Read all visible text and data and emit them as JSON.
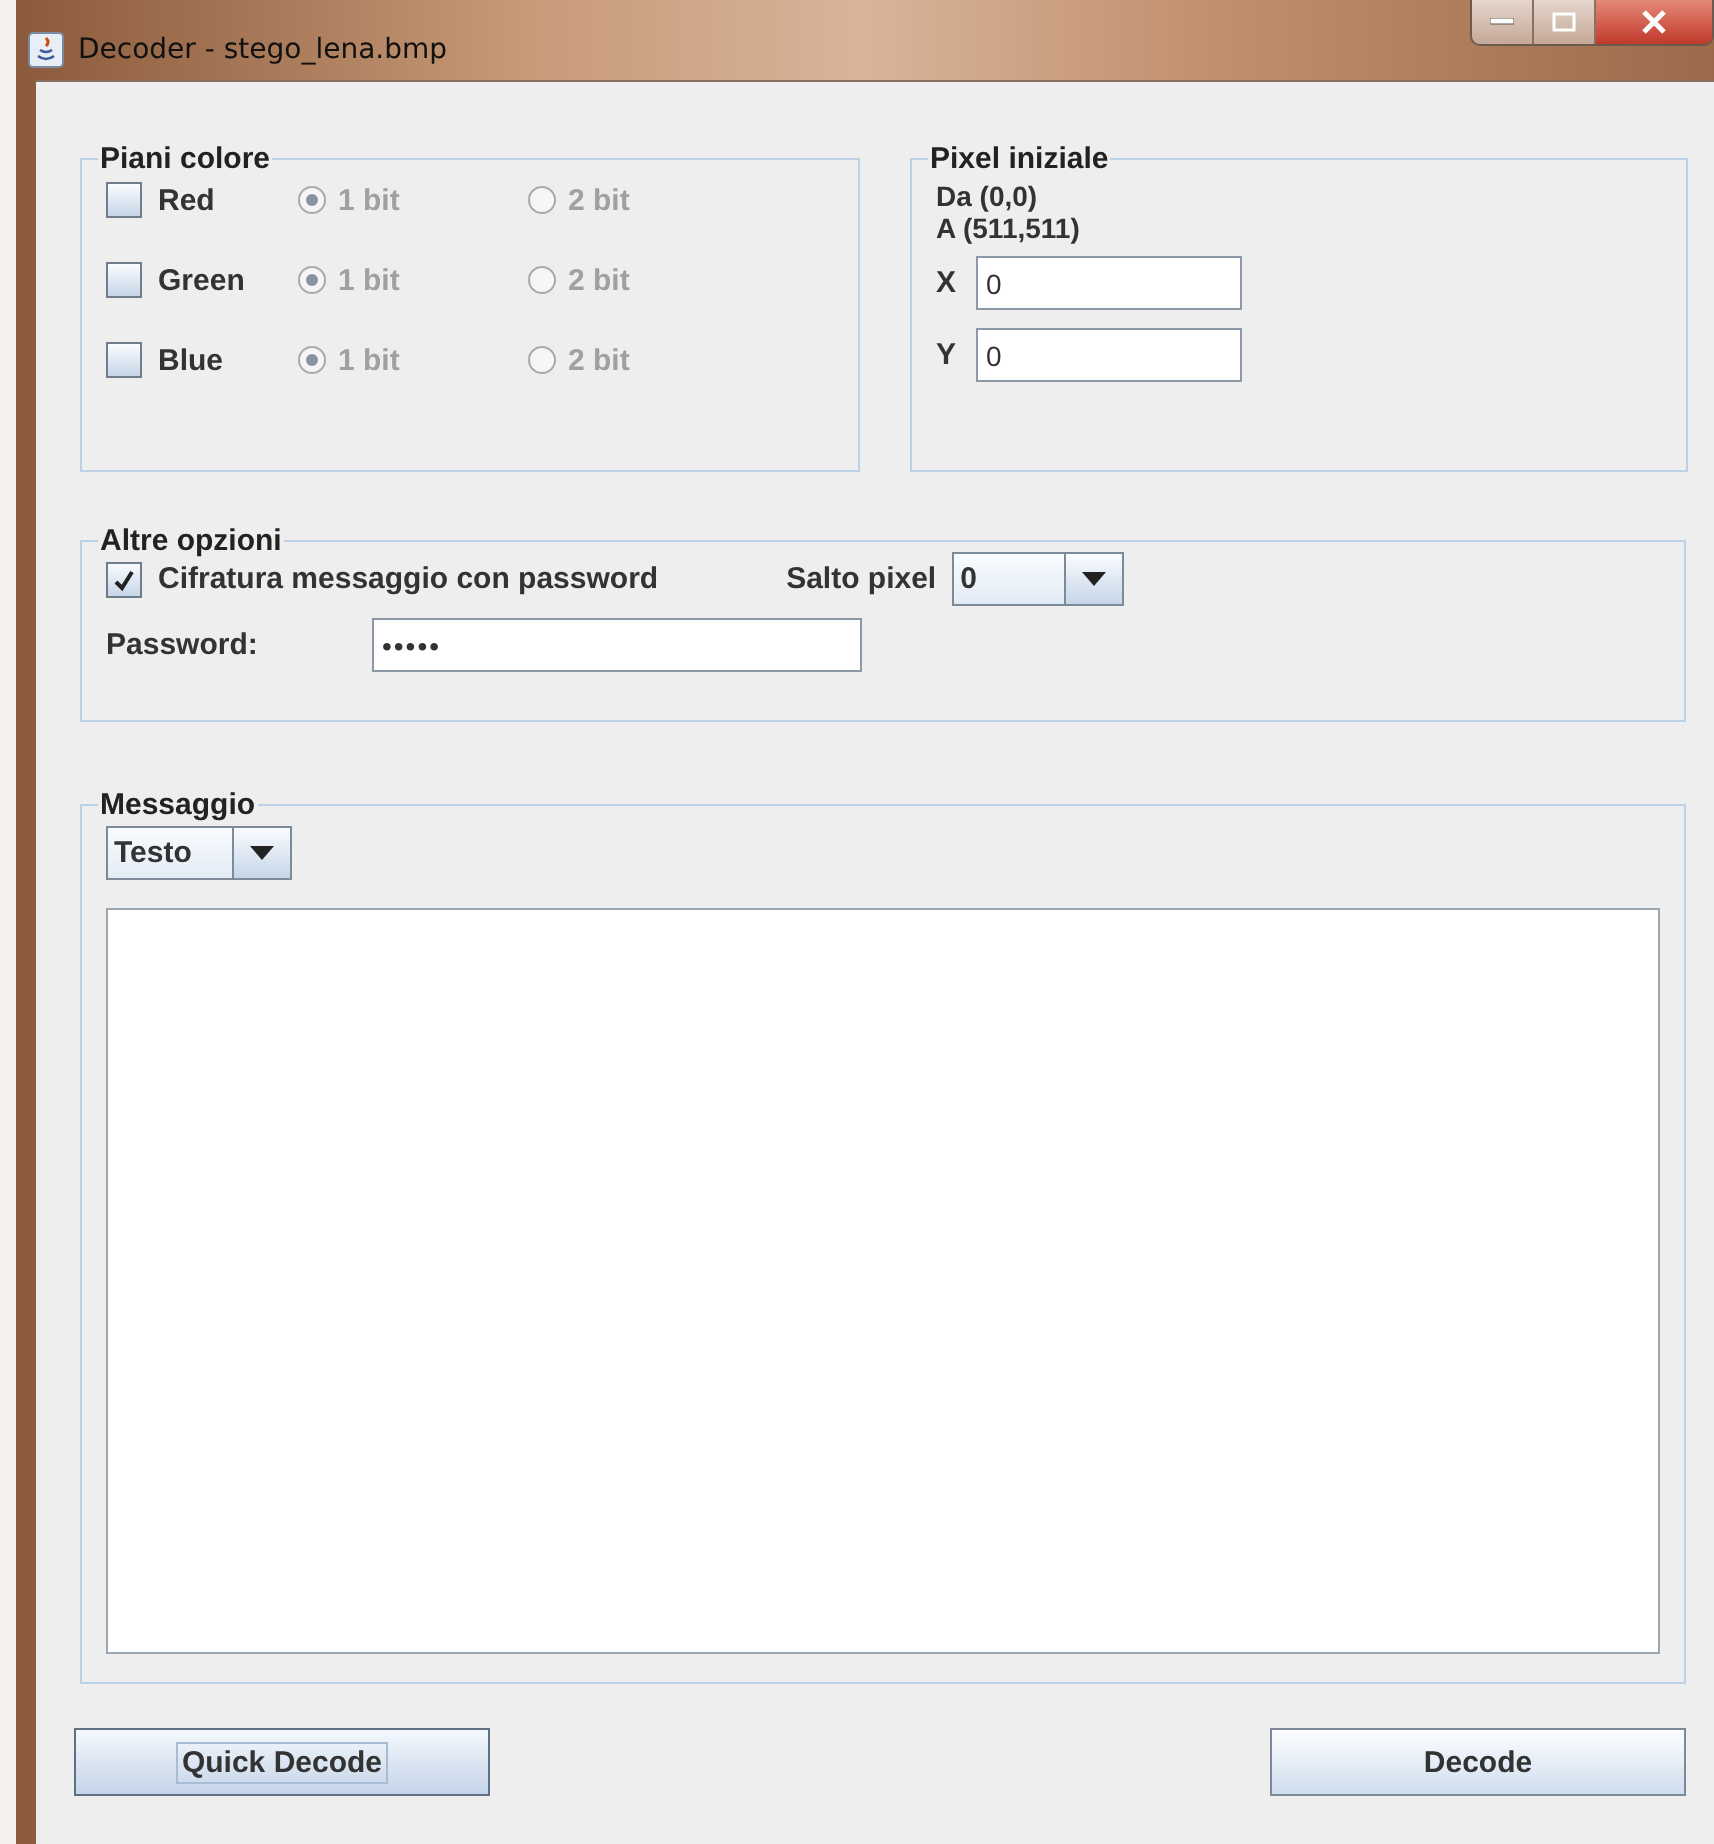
{
  "window": {
    "title": "Decoder - stego_lena.bmp"
  },
  "color_planes": {
    "title": "Piani colore",
    "channels": [
      {
        "label": "Red",
        "checked": false,
        "options": [
          {
            "label": "1 bit",
            "selected": true,
            "disabled": true
          },
          {
            "label": "2 bit",
            "selected": false,
            "disabled": true
          }
        ]
      },
      {
        "label": "Green",
        "checked": false,
        "options": [
          {
            "label": "1 bit",
            "selected": true,
            "disabled": true
          },
          {
            "label": "2 bit",
            "selected": false,
            "disabled": true
          }
        ]
      },
      {
        "label": "Blue",
        "checked": false,
        "options": [
          {
            "label": "1 bit",
            "selected": true,
            "disabled": true
          },
          {
            "label": "2 bit",
            "selected": false,
            "disabled": true
          }
        ]
      }
    ]
  },
  "pixel_start": {
    "title": "Pixel iniziale",
    "from": "Da (0,0)",
    "to": "A (511,511)",
    "fields": [
      {
        "label": "X",
        "value": "0"
      },
      {
        "label": "Y",
        "value": "0"
      }
    ]
  },
  "other_options": {
    "title": "Altre opzioni",
    "encrypt": {
      "label": "Cifratura messaggio con password",
      "checked": true
    },
    "skip": {
      "label": "Salto pixel",
      "value": "0"
    },
    "password": {
      "label": "Password:",
      "value": "•••••"
    }
  },
  "message": {
    "title": "Messaggio",
    "format": "Testo"
  },
  "buttons": [
    {
      "label": "Quick Decode",
      "focused": true
    },
    {
      "label": "Decode",
      "focused": false
    }
  ]
}
